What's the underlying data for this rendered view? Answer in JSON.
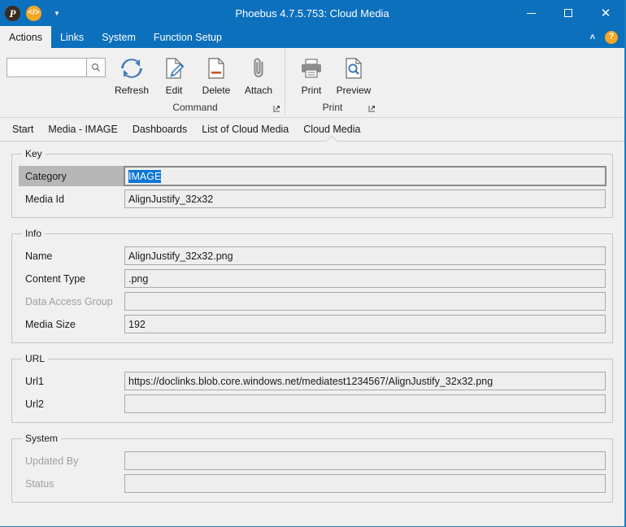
{
  "window": {
    "title": "Phoebus 4.7.5.753: Cloud Media",
    "app_icon": "P",
    "code_icon": "</>",
    "qat_dropdown_icon": "qat-dropdown-icon",
    "minimize_label": "—",
    "maximize_label": "□",
    "close_label": "✕"
  },
  "menubar": {
    "tabs": [
      {
        "label": "Actions",
        "active": true
      },
      {
        "label": "Links",
        "active": false
      },
      {
        "label": "System",
        "active": false
      },
      {
        "label": "Function Setup",
        "active": false
      }
    ],
    "collapse_icon": "˄",
    "help_label": "?"
  },
  "ribbon": {
    "search": {
      "value": "",
      "placeholder": ""
    },
    "groups": [
      {
        "name": "Command",
        "items": [
          {
            "label": "Refresh",
            "icon": "refresh-icon"
          },
          {
            "label": "Edit",
            "icon": "edit-icon"
          },
          {
            "label": "Delete",
            "icon": "delete-icon"
          },
          {
            "label": "Attach",
            "icon": "attach-icon"
          }
        ],
        "launcher": "⬌"
      },
      {
        "name": "Print",
        "items": [
          {
            "label": "Print",
            "icon": "print-icon"
          },
          {
            "label": "Preview",
            "icon": "preview-icon"
          }
        ],
        "launcher": "⬌"
      }
    ]
  },
  "breadcrumbs": [
    {
      "label": "Start",
      "active": false
    },
    {
      "label": "Media - IMAGE",
      "active": false
    },
    {
      "label": "Dashboards",
      "active": false
    },
    {
      "label": "List of Cloud Media",
      "active": false
    },
    {
      "label": "Cloud Media",
      "active": true
    }
  ],
  "form": {
    "key": {
      "legend": "Key",
      "category": {
        "label": "Category",
        "value": "IMAGE"
      },
      "media_id": {
        "label": "Media Id",
        "value": "AlignJustify_32x32"
      }
    },
    "info": {
      "legend": "Info",
      "name": {
        "label": "Name",
        "value": "AlignJustify_32x32.png"
      },
      "content_type": {
        "label": "Content Type",
        "value": ".png"
      },
      "data_access_group": {
        "label": "Data Access Group",
        "value": ""
      },
      "media_size": {
        "label": "Media Size",
        "value": "192"
      }
    },
    "url": {
      "legend": "URL",
      "url1": {
        "label": "Url1",
        "value": "https://doclinks.blob.core.windows.net/mediatest1234567/AlignJustify_32x32.png"
      },
      "url2": {
        "label": "Url2",
        "value": ""
      }
    },
    "system": {
      "legend": "System",
      "updated_by": {
        "label": "Updated By",
        "value": ""
      },
      "status": {
        "label": "Status",
        "value": ""
      }
    }
  },
  "colors": {
    "titlebar": "#0c70bd",
    "accent": "#0b76d4",
    "chrome": "#f0f0f0",
    "help": "#f5a623",
    "selection": "#0b76d4"
  }
}
